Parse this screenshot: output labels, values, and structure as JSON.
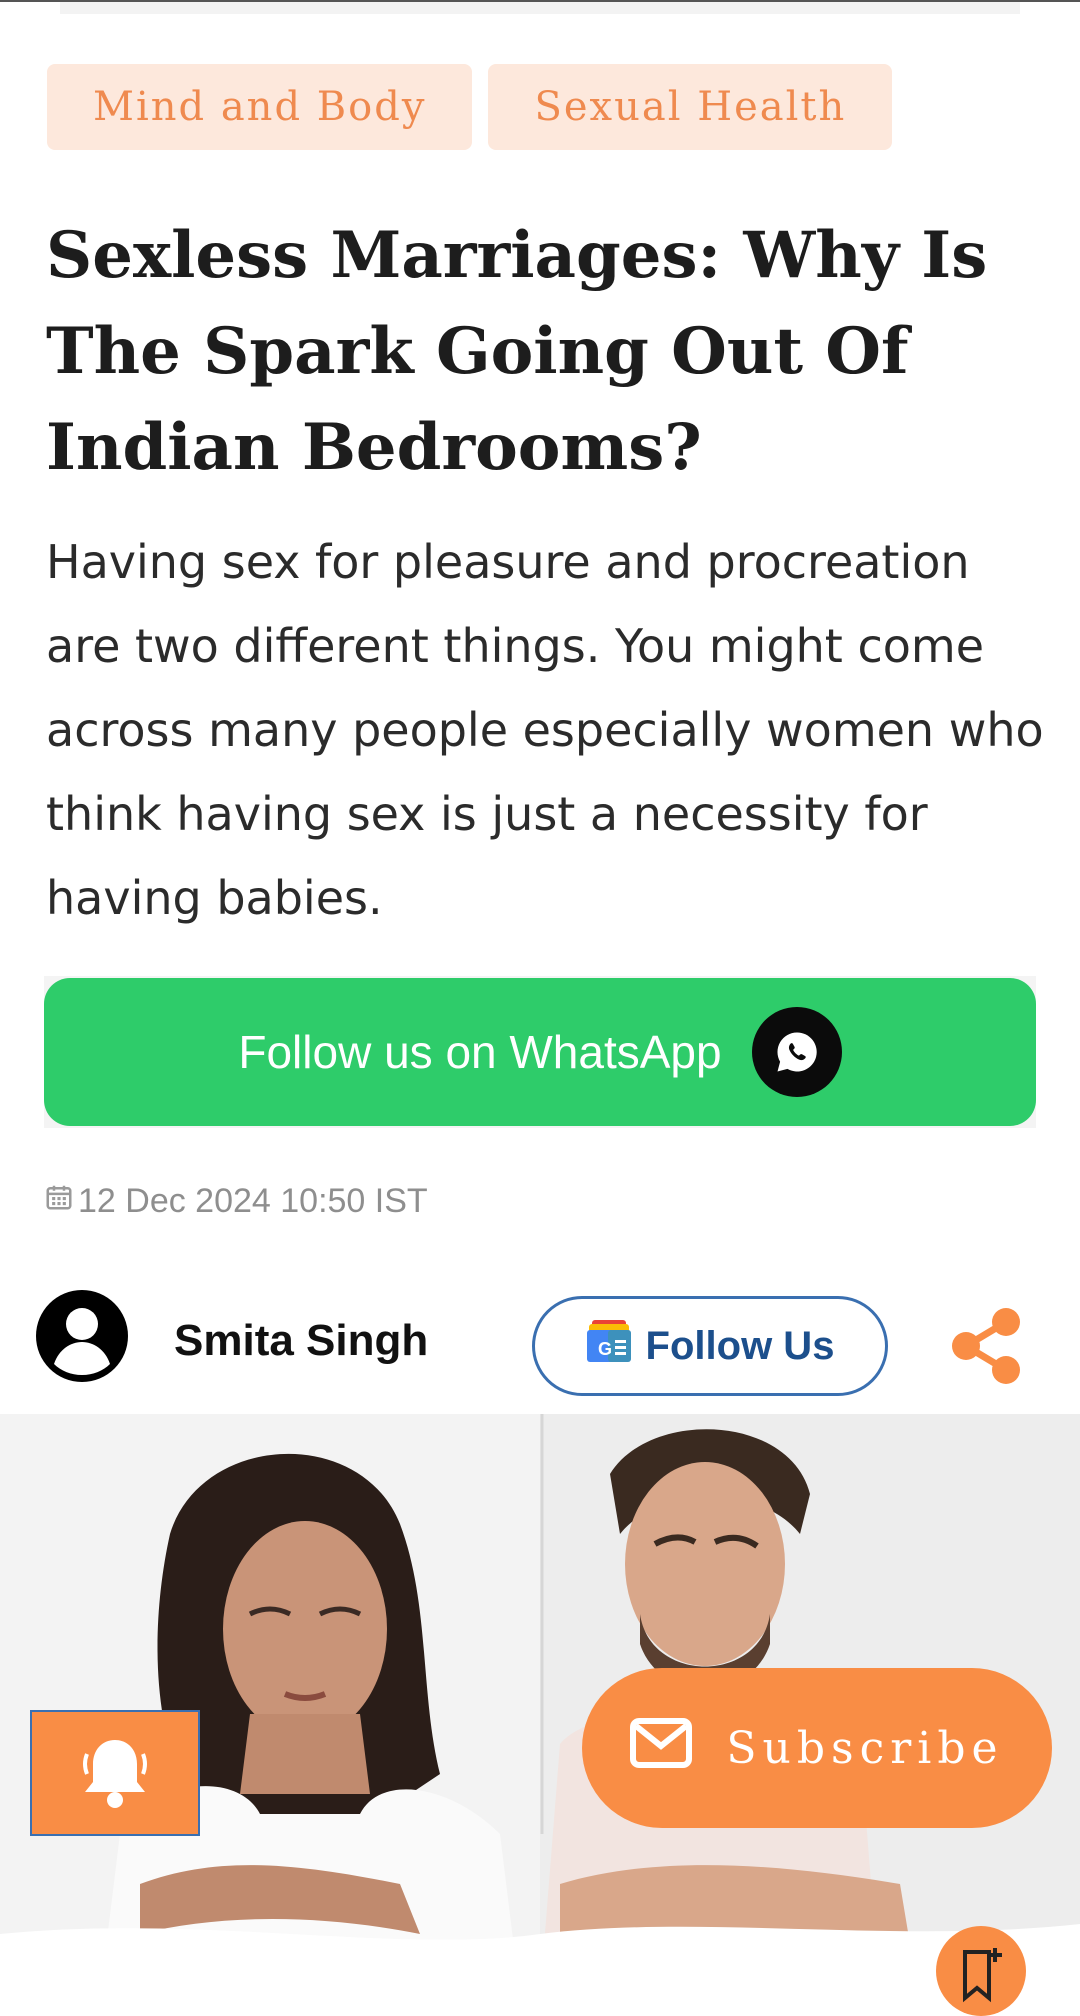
{
  "tags": [
    "Mind and Body",
    "Sexual Health"
  ],
  "article": {
    "headline": "Sexless Marriages: Why Is The Spark Going Out Of Indian Bedrooms?",
    "summary": "Having sex for pleasure and procreation are two different things. You might come across many people especially women who think having sex is just a necessity for having babies.",
    "date": "12 Dec 2024 10:50 IST"
  },
  "whatsapp": {
    "label": "Follow us on WhatsApp",
    "icon": "whatsapp-icon"
  },
  "author": {
    "name": "Smita Singh",
    "icon": "user-avatar-icon"
  },
  "follow_button": {
    "label": "Follow Us",
    "icon": "google-news-icon"
  },
  "share": {
    "icon": "share-icon"
  },
  "subscribe": {
    "label": "Subscribe",
    "icon": "mail-icon"
  },
  "notification": {
    "icon": "bell-icon"
  },
  "bookmark": {
    "icon": "bookmark-icon"
  },
  "colors": {
    "accent": "#f98d45",
    "tag_bg": "#fde8dc",
    "tag_text": "#ef8a4f",
    "whatsapp": "#2ecc6a",
    "follow_blue": "#1c4f8c"
  }
}
